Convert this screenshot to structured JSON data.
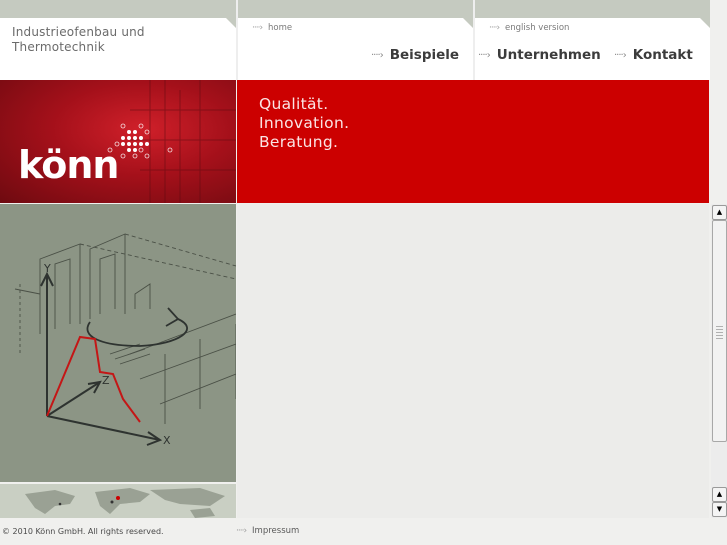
{
  "header": {
    "company_line1": "Industrieofenbau und",
    "company_line2": "Thermotechnik",
    "home_link": "home",
    "english_link": "english version",
    "nav": [
      {
        "label": "Beispiele"
      },
      {
        "label": "Unternehmen"
      },
      {
        "label": "Kontakt"
      }
    ]
  },
  "banner": {
    "logo_text": "könn",
    "slogan_line1": "Qualität.",
    "slogan_line2": "Innovation.",
    "slogan_line3": "Beratung."
  },
  "illustration": {
    "axis_y": "Y",
    "axis_z": "Z",
    "axis_x": "X"
  },
  "footer": {
    "copyright": "© 2010 Könn GmbH. All rights reserved.",
    "impressum": "Impressum"
  },
  "colors": {
    "brand_red": "#cc0000",
    "header_tab_grey": "#c5cac0",
    "illustration_bg": "#8c9585"
  },
  "icons": {
    "link_arrow": "dotted-arrow-icon",
    "scroll_up": "triangle-up-icon",
    "scroll_down": "triangle-down-icon"
  }
}
